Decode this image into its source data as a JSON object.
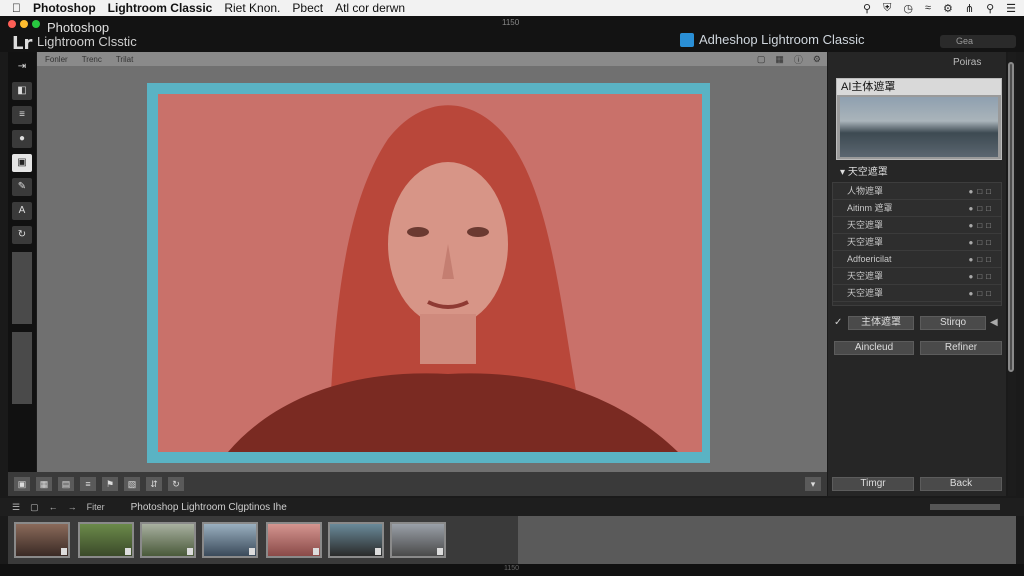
{
  "menubar": {
    "apple": "",
    "app": "Photoshop",
    "items": [
      "Lightroom Classic",
      "Riet Knon.",
      "Pbect",
      "Atl cor derwn"
    ],
    "status_icons": [
      "search-icon",
      "shield-icon",
      "clock-icon",
      "wifi-icon",
      "control-icon",
      "bluetooth-icon",
      "spotlight-icon",
      "menu-icon"
    ]
  },
  "titlebar": {
    "logo": "Lr",
    "name_line1": "Photoshop",
    "name_line2": "Lightroom Clsstic",
    "window_size": "1150",
    "brand": "Adheshop Lightroom Classic",
    "search_placeholder": "Gea"
  },
  "workspace": {
    "tabs": [
      "Fonler",
      "Trenc",
      "Trilat"
    ]
  },
  "right_panel": {
    "title": "Poiras",
    "ai_label": "AI主体遮罩",
    "mask_header": "天空遮罩",
    "masks": [
      "人物遮罩",
      "Aitinm 遮罩",
      "天空遮罩",
      "天空遮罩",
      "Adfoericilat",
      "天空遮罩",
      "天空遮罩"
    ],
    "btn_subject": "主体遮罩",
    "btn_stage": "Stirqo",
    "btn_add": "Aincleud",
    "btn_refine": "Refiner",
    "btn_timer": "Timgr",
    "btn_back": "Back"
  },
  "filmstrip": {
    "path": "Photoshop Lightroom Clgptinos Ihe",
    "label_fiter": "Fiter"
  },
  "footer": {
    "size": "1150"
  },
  "colors": {
    "mask_overlay": "#c87066",
    "frame": "#5ab3c4",
    "accent": "#2a8fd6"
  }
}
